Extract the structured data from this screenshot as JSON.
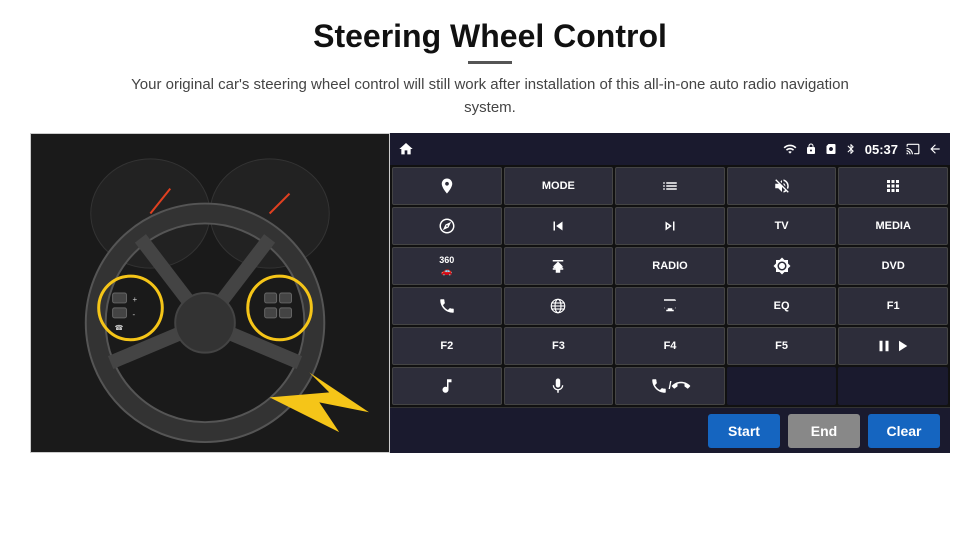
{
  "header": {
    "title": "Steering Wheel Control",
    "subtitle": "Your original car's steering wheel control will still work after installation of this all-in-one auto radio navigation system."
  },
  "status_bar": {
    "time": "05:37",
    "icons": [
      "wifi",
      "lock",
      "sim",
      "bt",
      "cast",
      "back"
    ]
  },
  "button_grid": [
    {
      "id": "r0c0",
      "type": "icon",
      "label": "home"
    },
    {
      "id": "r0c1",
      "type": "text",
      "label": "MODE"
    },
    {
      "id": "r0c2",
      "type": "icon",
      "label": "list"
    },
    {
      "id": "r0c3",
      "type": "icon",
      "label": "mute"
    },
    {
      "id": "r0c4",
      "type": "icon",
      "label": "apps"
    },
    {
      "id": "r1c0",
      "type": "icon",
      "label": "nav"
    },
    {
      "id": "r1c1",
      "type": "icon",
      "label": "prev"
    },
    {
      "id": "r1c2",
      "type": "icon",
      "label": "next"
    },
    {
      "id": "r1c3",
      "type": "text",
      "label": "TV"
    },
    {
      "id": "r1c4",
      "type": "text",
      "label": "MEDIA"
    },
    {
      "id": "r2c0",
      "type": "text",
      "label": "360"
    },
    {
      "id": "r2c1",
      "type": "icon",
      "label": "eject"
    },
    {
      "id": "r2c2",
      "type": "text",
      "label": "RADIO"
    },
    {
      "id": "r2c3",
      "type": "icon",
      "label": "brightness"
    },
    {
      "id": "r2c4",
      "type": "text",
      "label": "DVD"
    },
    {
      "id": "r3c0",
      "type": "icon",
      "label": "phone"
    },
    {
      "id": "r3c1",
      "type": "icon",
      "label": "ie"
    },
    {
      "id": "r3c2",
      "type": "icon",
      "label": "screen"
    },
    {
      "id": "r3c3",
      "type": "text",
      "label": "EQ"
    },
    {
      "id": "r3c4",
      "type": "text",
      "label": "F1"
    },
    {
      "id": "r4c0",
      "type": "text",
      "label": "F2"
    },
    {
      "id": "r4c1",
      "type": "text",
      "label": "F3"
    },
    {
      "id": "r4c2",
      "type": "text",
      "label": "F4"
    },
    {
      "id": "r4c3",
      "type": "text",
      "label": "F5"
    },
    {
      "id": "r4c4",
      "type": "icon",
      "label": "play-pause"
    },
    {
      "id": "r5c0",
      "type": "icon",
      "label": "music"
    },
    {
      "id": "r5c1",
      "type": "icon",
      "label": "mic"
    },
    {
      "id": "r5c2",
      "type": "icon",
      "label": "phone-audio"
    },
    {
      "id": "r5c3",
      "type": "text",
      "label": ""
    },
    {
      "id": "r5c4",
      "type": "text",
      "label": ""
    }
  ],
  "action_bar": {
    "start_label": "Start",
    "end_label": "End",
    "clear_label": "Clear"
  }
}
